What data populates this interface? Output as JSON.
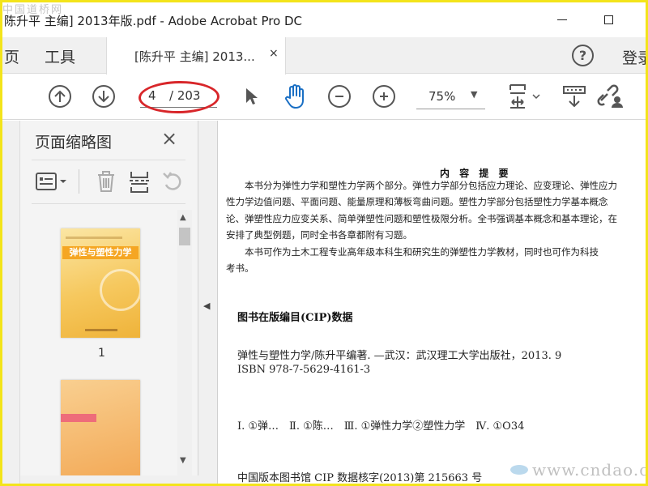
{
  "window": {
    "title": "陈升平 主编] 2013年版.pdf - Adobe Acrobat Pro DC",
    "watermark_top": "中国道桥网"
  },
  "tabs": {
    "nav_page": "页",
    "nav_tools": "工具",
    "doc_tab_label": "[陈升平 主编] 2013...",
    "doc_tab_close": "×",
    "help": "?",
    "sign_in": "登录"
  },
  "toolbar": {
    "current_page": "4",
    "total_pages": "/ 203",
    "zoom": "75%",
    "zoom_caret": "▼"
  },
  "panel": {
    "title": "页面缩略图",
    "close": "×",
    "thumbnails": [
      {
        "page_label": "1",
        "cover_title": "弹性与塑性力学"
      },
      {
        "page_label": ""
      }
    ]
  },
  "document": {
    "heading": "内 容 提 要",
    "paragraph_lines": [
      "　　本书分为弹性力学和塑性力学两个部分。弹性力学部分包括应力理论、应变理论、弹性应力",
      "性力学边值问题、平面问题、能量原理和薄板弯曲问题。塑性力学部分包括塑性力学基本概念",
      "论、弹塑性应力应变关系、简单弹塑性问题和塑性极限分析。全书强调基本概念和基本理论，在",
      "安排了典型例题，同时全书各章都附有习题。",
      "　　本书可作为土木工程专业高年级本科生和研究生的弹塑性力学教材，同时也可作为科技",
      "考书。"
    ],
    "cip_title": "图书在版编目(CIP)数据",
    "cip_lines": [
      "弹性与塑性力学/陈升平编著. —武汉：武汉理工大学出版社，2013. 9",
      "ISBN 978-7-5629-4161-3",
      "Ⅰ. ①弹…　Ⅱ. ①陈…　Ⅲ. ①弹性力学②塑性力学　Ⅳ. ①O34",
      "中国版本图书馆 CIP 数据核字(2013)第 215663 号"
    ],
    "watermark_bottom": "www.cndao.com"
  },
  "colors": {
    "highlight_ellipse": "#d8262a",
    "frame_border": "#f3e41b",
    "cover_orange": "#f5a623"
  }
}
